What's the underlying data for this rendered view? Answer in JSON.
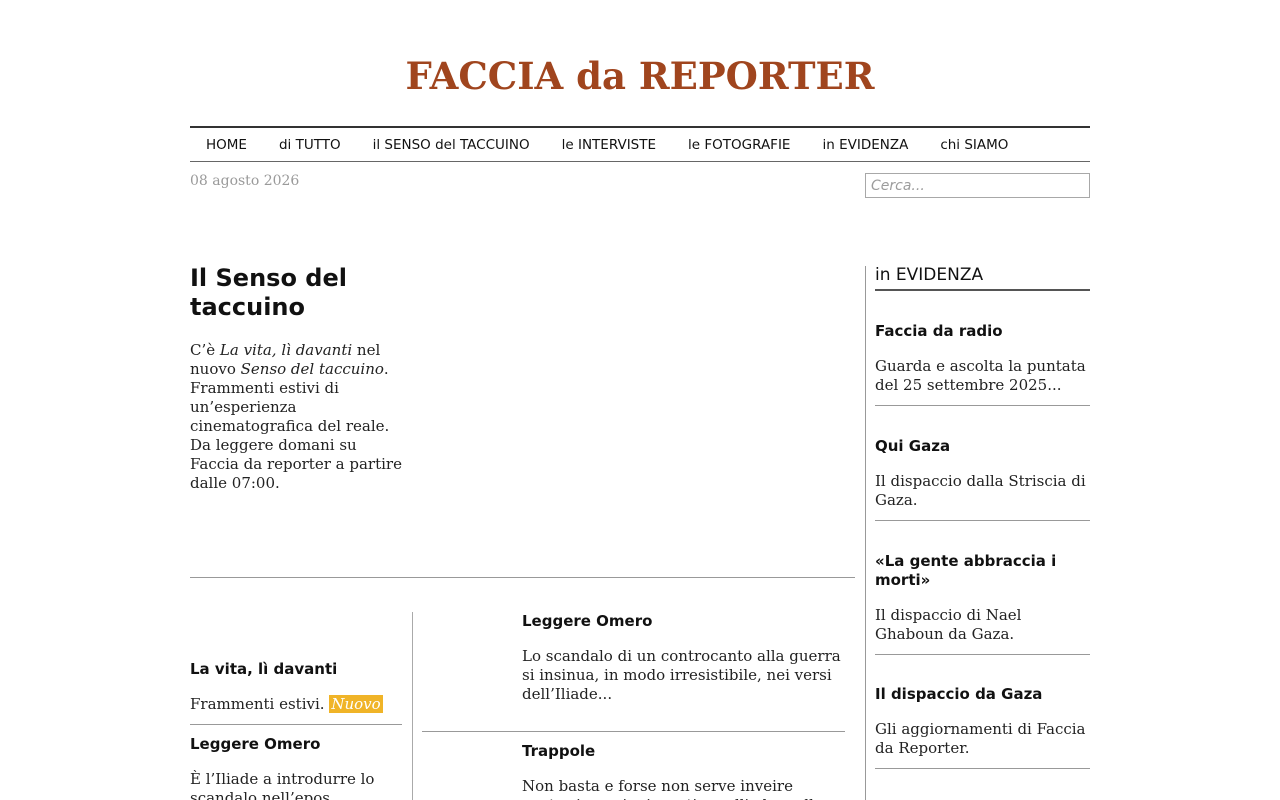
{
  "site": {
    "logo_part1": "FACCIA",
    "logo_part2": "da",
    "logo_part3": "REPORTER",
    "logo_color": "#a0451e"
  },
  "nav": {
    "items": [
      {
        "label": "HOME"
      },
      {
        "label": "di TUTTO"
      },
      {
        "label": "il SENSO del TACCUINO"
      },
      {
        "label": "le INTERVISTE"
      },
      {
        "label": "le FOTOGRAFIE"
      },
      {
        "label": "in EVIDENZA"
      },
      {
        "label": "chi SIAMO"
      }
    ]
  },
  "date": "08 agosto 2026",
  "search": {
    "placeholder": "Cerca...",
    "value": ""
  },
  "feature": {
    "title": "Il Senso del taccuino",
    "text_part1": "C’è ",
    "text_italic1": "La vita, lì davanti",
    "text_part2": " nel nuovo ",
    "text_italic2": "Senso del taccuino",
    "text_part3": ". Frammenti estivi di un’esperienza cinematografica del reale. Da leggere domani su Faccia da reporter a partire dalle 07:00."
  },
  "left_column": {
    "stories": [
      {
        "title": "La vita, lì davanti",
        "text": "Frammenti estivi.",
        "badge": "Nuovo",
        "badge_color": "#f0b428"
      },
      {
        "title": "Leggere Omero",
        "text": "È l’Iliade a introdurre lo scandalo nell’epos"
      }
    ]
  },
  "middle_column": {
    "stories": [
      {
        "title": "Leggere Omero",
        "text": "Lo scandalo di un controcanto alla guerra si insinua, in modo irresistibile, nei versi dell’Iliade..."
      },
      {
        "title": "Trappole",
        "text": "Non basta e forse non serve inveire contro i nuovi migranti, quelli che nella città"
      }
    ]
  },
  "sidebar": {
    "title": "in EVIDENZA",
    "items": [
      {
        "title": "Faccia da radio",
        "text": "Guarda e ascolta la puntata del 25 settembre 2025..."
      },
      {
        "title": "Qui Gaza",
        "text": "Il dispaccio dalla Striscia di Gaza."
      },
      {
        "title": "«La gente abbraccia i morti»",
        "text": "Il dispaccio di Nael Ghaboun da Gaza."
      },
      {
        "title": "Il dispaccio da Gaza",
        "text": "Gli aggiornamenti di Faccia da Reporter."
      }
    ]
  }
}
